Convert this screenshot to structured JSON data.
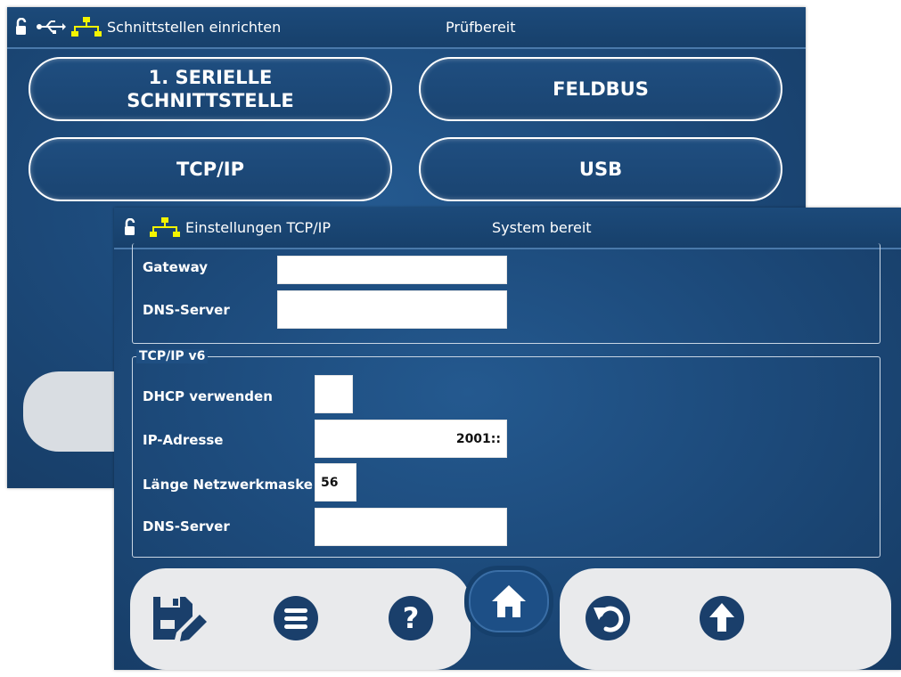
{
  "back_screen": {
    "statusbar": {
      "title": "Schnittstellen einrichten",
      "state": "Prüfbereit"
    },
    "buttons": [
      {
        "label_line1": "1. SERIELLE",
        "label_line2": "SCHNITTSTELLE"
      },
      {
        "label": "FELDBUS"
      },
      {
        "label": "TCP/IP"
      },
      {
        "label": "USB"
      }
    ]
  },
  "front_screen": {
    "statusbar": {
      "title": "Einstellungen TCP/IP",
      "state": "System bereit"
    },
    "ipv4_section": {
      "fields": [
        {
          "label": "Gateway",
          "value": ""
        },
        {
          "label": "DNS-Server",
          "value": ""
        }
      ]
    },
    "ipv6_section": {
      "legend": "TCP/IP v6",
      "dhcp_label": "DHCP verwenden",
      "dhcp_checked": false,
      "ip_label": "IP-Adresse",
      "ip_value": "2001::",
      "mask_label": "Länge Netzwerkmaske",
      "mask_value": "56",
      "dns_label": "DNS-Server",
      "dns_value": ""
    },
    "toolbar": {
      "icons": [
        "save-edit-icon",
        "menu-icon",
        "help-icon",
        "home-icon",
        "undo-icon",
        "up-arrow-icon"
      ]
    }
  },
  "colors": {
    "background_blue": "#1d4b7c",
    "network_icon_yellow": "#f4f400",
    "toolbar_gray": "#e9eaec",
    "icon_navy": "#1a3f6b"
  }
}
